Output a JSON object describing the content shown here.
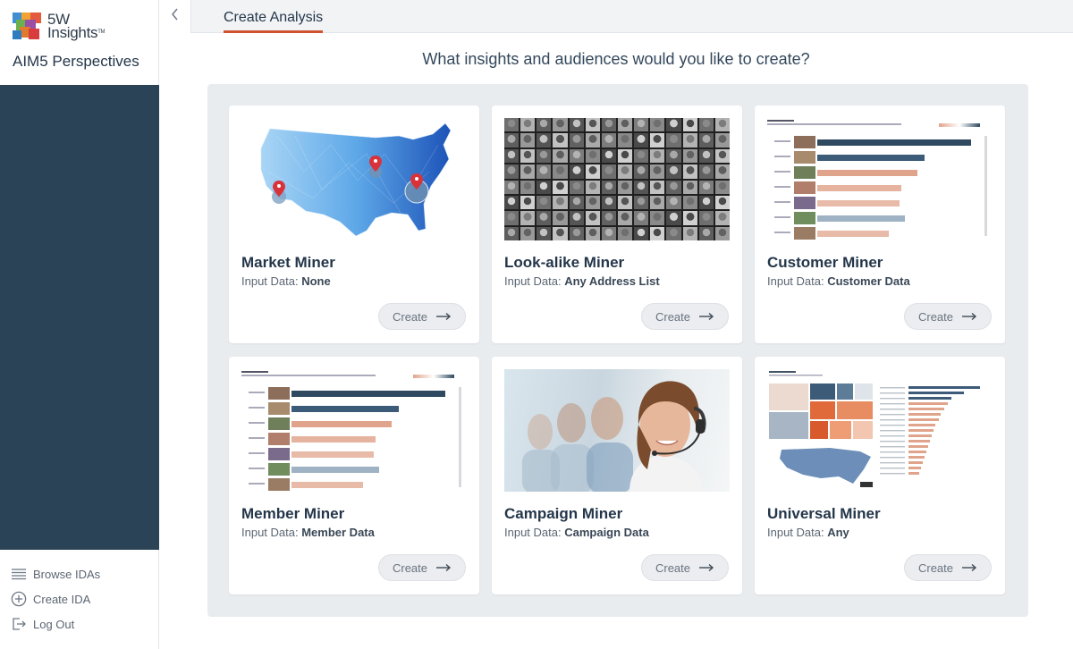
{
  "brand": {
    "logo_line1": "5W",
    "logo_line2": "Insights",
    "logo_tm": "TM",
    "app_name": "AIM5 Perspectives"
  },
  "nav": [
    {
      "label": "Browse IDAs",
      "icon": "list-icon"
    },
    {
      "label": "Create IDA",
      "icon": "plus-circle-icon"
    },
    {
      "label": "Log Out",
      "icon": "logout-icon"
    }
  ],
  "topbar": {
    "tab_label": "Create Analysis",
    "collapse_icon": "chevron-left-icon"
  },
  "prompt": "What insights and audiences would you like to create?",
  "input_prefix": "Input Data: ",
  "cards": [
    {
      "title": "Market Miner",
      "input": "None",
      "button": "Create"
    },
    {
      "title": "Look-alike Miner",
      "input": "Any Address List",
      "button": "Create"
    },
    {
      "title": "Customer Miner",
      "input": "Customer Data",
      "button": "Create"
    },
    {
      "title": "Member Miner",
      "input": "Member Data",
      "button": "Create"
    },
    {
      "title": "Campaign Miner",
      "input": "Campaign Data",
      "button": "Create"
    },
    {
      "title": "Universal Miner",
      "input": "Any",
      "button": "Create"
    }
  ],
  "colors": {
    "sidebar": "#2a4357",
    "accent": "#d0532f",
    "navy_bar": "#2f4a60",
    "salmon_bar": "#e0a48c"
  }
}
